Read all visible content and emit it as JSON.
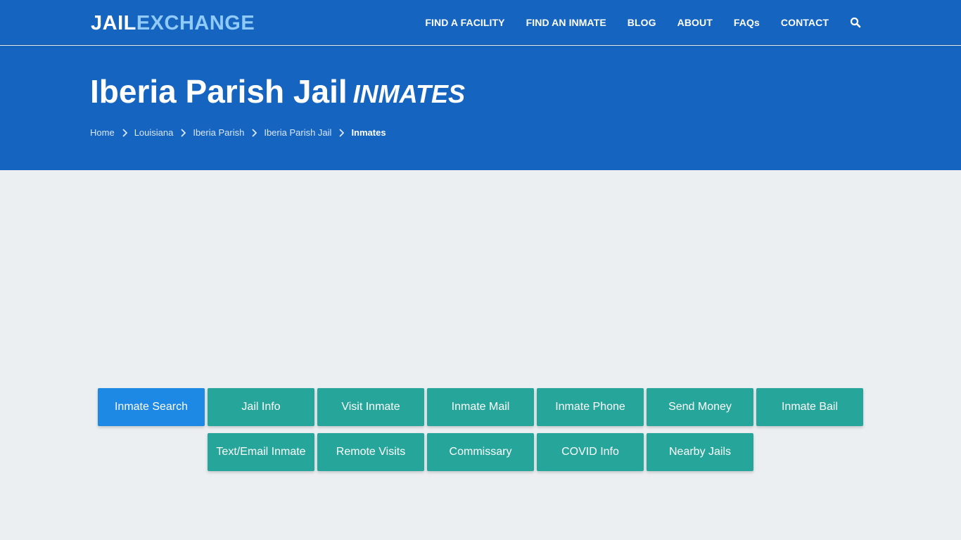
{
  "brand": {
    "part1": "JAIL",
    "part2": "EXCHANGE"
  },
  "nav": [
    {
      "label": "FIND A FACILITY"
    },
    {
      "label": "FIND AN INMATE"
    },
    {
      "label": "BLOG"
    },
    {
      "label": "ABOUT"
    },
    {
      "label": "FAQs"
    },
    {
      "label": "CONTACT"
    }
  ],
  "hero": {
    "title": "Iberia Parish Jail",
    "title_em": "INMATES"
  },
  "breadcrumb": [
    "Home",
    "Louisiana",
    "Iberia Parish",
    "Iberia Parish Jail"
  ],
  "breadcrumb_current": "Inmates",
  "buttons_row1": [
    "Inmate Search",
    "Jail Info",
    "Visit Inmate",
    "Inmate Mail",
    "Inmate Phone",
    "Send Money",
    "Inmate Bail"
  ],
  "buttons_row2": [
    "Text/Email Inmate",
    "Remote Visits",
    "Commissary",
    "COVID Info",
    "Nearby Jails"
  ],
  "colors": {
    "header": "#1565c0",
    "teal": "#26a69a",
    "active": "#1e88e5",
    "background": "#eceff2"
  }
}
